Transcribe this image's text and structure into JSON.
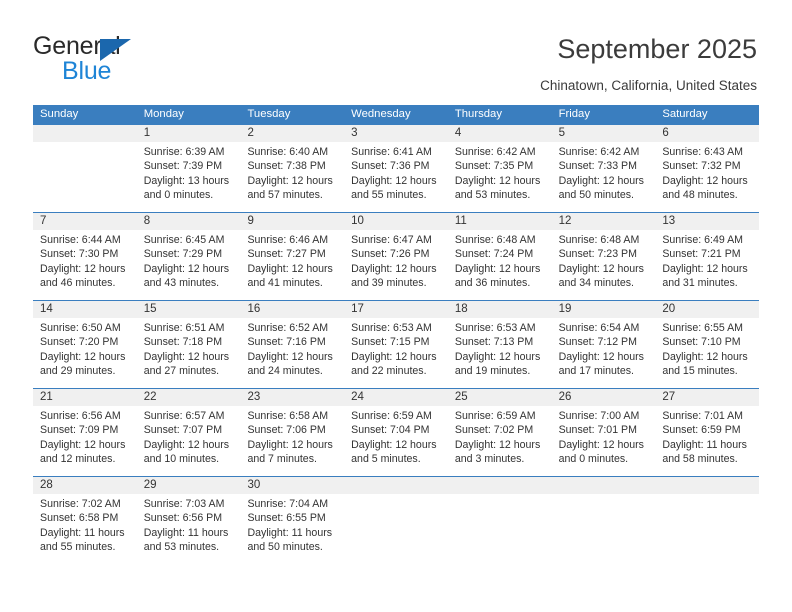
{
  "brand": {
    "name_top": "General",
    "name_bottom": "Blue",
    "color_dark": "#2a2a2a",
    "color_blue": "#1e84d6",
    "triangle_color": "#1b67ad"
  },
  "header": {
    "title": "September 2025",
    "subtitle": "Chinatown, California, United States"
  },
  "theme": {
    "header_row_bg": "#3a7ebf",
    "daynum_bg": "#f0f0f0",
    "text": "#333333",
    "divider": "#3a7ebf"
  },
  "weekdays": [
    "Sunday",
    "Monday",
    "Tuesday",
    "Wednesday",
    "Thursday",
    "Friday",
    "Saturday"
  ],
  "weeks": [
    {
      "numbers": [
        "",
        "1",
        "2",
        "3",
        "4",
        "5",
        "6"
      ],
      "cells": [
        {
          "sunrise": "",
          "sunset": "",
          "daylight1": "",
          "daylight2": ""
        },
        {
          "sunrise": "Sunrise: 6:39 AM",
          "sunset": "Sunset: 7:39 PM",
          "daylight1": "Daylight: 13 hours",
          "daylight2": "and 0 minutes."
        },
        {
          "sunrise": "Sunrise: 6:40 AM",
          "sunset": "Sunset: 7:38 PM",
          "daylight1": "Daylight: 12 hours",
          "daylight2": "and 57 minutes."
        },
        {
          "sunrise": "Sunrise: 6:41 AM",
          "sunset": "Sunset: 7:36 PM",
          "daylight1": "Daylight: 12 hours",
          "daylight2": "and 55 minutes."
        },
        {
          "sunrise": "Sunrise: 6:42 AM",
          "sunset": "Sunset: 7:35 PM",
          "daylight1": "Daylight: 12 hours",
          "daylight2": "and 53 minutes."
        },
        {
          "sunrise": "Sunrise: 6:42 AM",
          "sunset": "Sunset: 7:33 PM",
          "daylight1": "Daylight: 12 hours",
          "daylight2": "and 50 minutes."
        },
        {
          "sunrise": "Sunrise: 6:43 AM",
          "sunset": "Sunset: 7:32 PM",
          "daylight1": "Daylight: 12 hours",
          "daylight2": "and 48 minutes."
        }
      ]
    },
    {
      "numbers": [
        "7",
        "8",
        "9",
        "10",
        "11",
        "12",
        "13"
      ],
      "cells": [
        {
          "sunrise": "Sunrise: 6:44 AM",
          "sunset": "Sunset: 7:30 PM",
          "daylight1": "Daylight: 12 hours",
          "daylight2": "and 46 minutes."
        },
        {
          "sunrise": "Sunrise: 6:45 AM",
          "sunset": "Sunset: 7:29 PM",
          "daylight1": "Daylight: 12 hours",
          "daylight2": "and 43 minutes."
        },
        {
          "sunrise": "Sunrise: 6:46 AM",
          "sunset": "Sunset: 7:27 PM",
          "daylight1": "Daylight: 12 hours",
          "daylight2": "and 41 minutes."
        },
        {
          "sunrise": "Sunrise: 6:47 AM",
          "sunset": "Sunset: 7:26 PM",
          "daylight1": "Daylight: 12 hours",
          "daylight2": "and 39 minutes."
        },
        {
          "sunrise": "Sunrise: 6:48 AM",
          "sunset": "Sunset: 7:24 PM",
          "daylight1": "Daylight: 12 hours",
          "daylight2": "and 36 minutes."
        },
        {
          "sunrise": "Sunrise: 6:48 AM",
          "sunset": "Sunset: 7:23 PM",
          "daylight1": "Daylight: 12 hours",
          "daylight2": "and 34 minutes."
        },
        {
          "sunrise": "Sunrise: 6:49 AM",
          "sunset": "Sunset: 7:21 PM",
          "daylight1": "Daylight: 12 hours",
          "daylight2": "and 31 minutes."
        }
      ]
    },
    {
      "numbers": [
        "14",
        "15",
        "16",
        "17",
        "18",
        "19",
        "20"
      ],
      "cells": [
        {
          "sunrise": "Sunrise: 6:50 AM",
          "sunset": "Sunset: 7:20 PM",
          "daylight1": "Daylight: 12 hours",
          "daylight2": "and 29 minutes."
        },
        {
          "sunrise": "Sunrise: 6:51 AM",
          "sunset": "Sunset: 7:18 PM",
          "daylight1": "Daylight: 12 hours",
          "daylight2": "and 27 minutes."
        },
        {
          "sunrise": "Sunrise: 6:52 AM",
          "sunset": "Sunset: 7:16 PM",
          "daylight1": "Daylight: 12 hours",
          "daylight2": "and 24 minutes."
        },
        {
          "sunrise": "Sunrise: 6:53 AM",
          "sunset": "Sunset: 7:15 PM",
          "daylight1": "Daylight: 12 hours",
          "daylight2": "and 22 minutes."
        },
        {
          "sunrise": "Sunrise: 6:53 AM",
          "sunset": "Sunset: 7:13 PM",
          "daylight1": "Daylight: 12 hours",
          "daylight2": "and 19 minutes."
        },
        {
          "sunrise": "Sunrise: 6:54 AM",
          "sunset": "Sunset: 7:12 PM",
          "daylight1": "Daylight: 12 hours",
          "daylight2": "and 17 minutes."
        },
        {
          "sunrise": "Sunrise: 6:55 AM",
          "sunset": "Sunset: 7:10 PM",
          "daylight1": "Daylight: 12 hours",
          "daylight2": "and 15 minutes."
        }
      ]
    },
    {
      "numbers": [
        "21",
        "22",
        "23",
        "24",
        "25",
        "26",
        "27"
      ],
      "cells": [
        {
          "sunrise": "Sunrise: 6:56 AM",
          "sunset": "Sunset: 7:09 PM",
          "daylight1": "Daylight: 12 hours",
          "daylight2": "and 12 minutes."
        },
        {
          "sunrise": "Sunrise: 6:57 AM",
          "sunset": "Sunset: 7:07 PM",
          "daylight1": "Daylight: 12 hours",
          "daylight2": "and 10 minutes."
        },
        {
          "sunrise": "Sunrise: 6:58 AM",
          "sunset": "Sunset: 7:06 PM",
          "daylight1": "Daylight: 12 hours",
          "daylight2": "and 7 minutes."
        },
        {
          "sunrise": "Sunrise: 6:59 AM",
          "sunset": "Sunset: 7:04 PM",
          "daylight1": "Daylight: 12 hours",
          "daylight2": "and 5 minutes."
        },
        {
          "sunrise": "Sunrise: 6:59 AM",
          "sunset": "Sunset: 7:02 PM",
          "daylight1": "Daylight: 12 hours",
          "daylight2": "and 3 minutes."
        },
        {
          "sunrise": "Sunrise: 7:00 AM",
          "sunset": "Sunset: 7:01 PM",
          "daylight1": "Daylight: 12 hours",
          "daylight2": "and 0 minutes."
        },
        {
          "sunrise": "Sunrise: 7:01 AM",
          "sunset": "Sunset: 6:59 PM",
          "daylight1": "Daylight: 11 hours",
          "daylight2": "and 58 minutes."
        }
      ]
    },
    {
      "numbers": [
        "28",
        "29",
        "30",
        "",
        "",
        "",
        ""
      ],
      "cells": [
        {
          "sunrise": "Sunrise: 7:02 AM",
          "sunset": "Sunset: 6:58 PM",
          "daylight1": "Daylight: 11 hours",
          "daylight2": "and 55 minutes."
        },
        {
          "sunrise": "Sunrise: 7:03 AM",
          "sunset": "Sunset: 6:56 PM",
          "daylight1": "Daylight: 11 hours",
          "daylight2": "and 53 minutes."
        },
        {
          "sunrise": "Sunrise: 7:04 AM",
          "sunset": "Sunset: 6:55 PM",
          "daylight1": "Daylight: 11 hours",
          "daylight2": "and 50 minutes."
        },
        {
          "sunrise": "",
          "sunset": "",
          "daylight1": "",
          "daylight2": ""
        },
        {
          "sunrise": "",
          "sunset": "",
          "daylight1": "",
          "daylight2": ""
        },
        {
          "sunrise": "",
          "sunset": "",
          "daylight1": "",
          "daylight2": ""
        },
        {
          "sunrise": "",
          "sunset": "",
          "daylight1": "",
          "daylight2": ""
        }
      ]
    }
  ]
}
